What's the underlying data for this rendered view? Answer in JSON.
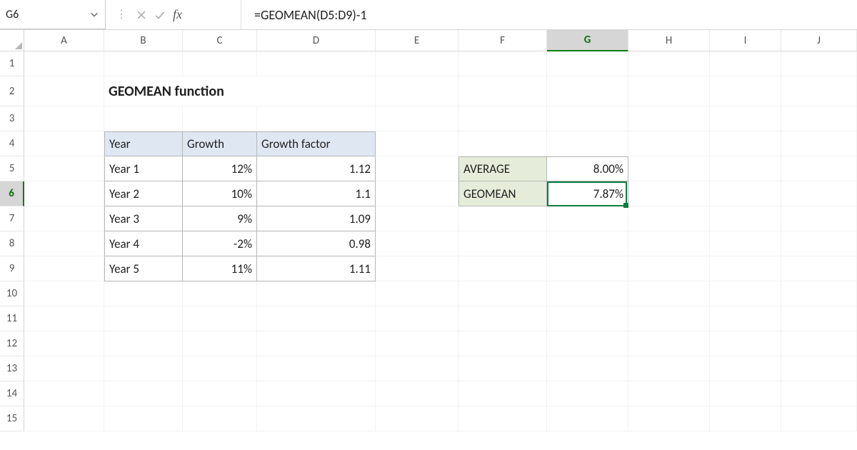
{
  "name_box": "G6",
  "formula": "=GEOMEAN(D5:D9)-1",
  "columns": [
    "A",
    "B",
    "C",
    "D",
    "E",
    "F",
    "G",
    "H",
    "I",
    "J"
  ],
  "active_col": "G",
  "active_row": 6,
  "row_count": 15,
  "title": "GEOMEAN function",
  "table": {
    "headers": [
      "Year",
      "Growth",
      "Growth factor"
    ],
    "rows": [
      {
        "year": "Year 1",
        "growth": "12%",
        "factor": "1.12"
      },
      {
        "year": "Year 2",
        "growth": "10%",
        "factor": "1.1"
      },
      {
        "year": "Year 3",
        "growth": "9%",
        "factor": "1.09"
      },
      {
        "year": "Year 4",
        "growth": "-2%",
        "factor": "0.98"
      },
      {
        "year": "Year 5",
        "growth": "11%",
        "factor": "1.11"
      }
    ]
  },
  "results": {
    "average_label": "AVERAGE",
    "average_value": "8.00%",
    "geomean_label": "GEOMEAN",
    "geomean_value": "7.87%"
  }
}
